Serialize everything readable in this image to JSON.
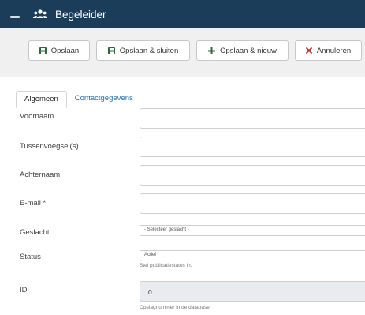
{
  "header": {
    "title": "Begeleider",
    "logo_icon": "menu-toggle-icon",
    "title_icon": "users-icon",
    "colors": {
      "background": "#1c3d5a",
      "text": "#ffffff"
    }
  },
  "toolbar": {
    "save_label": "Opslaan",
    "save_close_label": "Opslaan & sluiten",
    "save_new_label": "Opslaan & nieuw",
    "cancel_label": "Annuleren",
    "icons": {
      "save": "save-icon",
      "save_close": "save-icon",
      "save_new": "plus-icon",
      "cancel": "close-icon"
    },
    "colors": {
      "save_icon": "#2e6b3a",
      "plus_icon": "#2e6b3a",
      "cancel_icon": "#c62828"
    }
  },
  "tabs": [
    {
      "label": "Algemeen",
      "active": true
    },
    {
      "label": "Contactgegevens",
      "active": false
    }
  ],
  "form": {
    "voornaam": {
      "label": "Voornaam",
      "value": ""
    },
    "tussenvoegsel": {
      "label": "Tussenvoegsel(s)",
      "value": ""
    },
    "achternaam": {
      "label": "Achternaam",
      "value": ""
    },
    "email": {
      "label": "E-mail *",
      "value": ""
    },
    "geslacht": {
      "label": "Geslacht",
      "selected": "- Selecteer geslacht -"
    },
    "status": {
      "label": "Status",
      "selected": "Actief",
      "help": "Stel publicatiestatus in."
    },
    "id": {
      "label": "ID",
      "value": "0",
      "help": "Opslagnummer in de database"
    }
  }
}
